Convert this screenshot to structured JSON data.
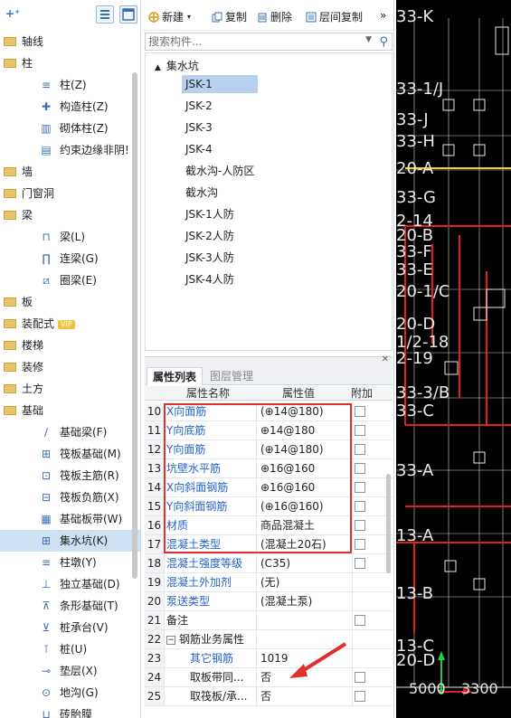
{
  "left_panel": {
    "categories": [
      {
        "label": "轴线",
        "expanded": false
      },
      {
        "label": "柱",
        "expanded": true,
        "items": [
          "柱(Z)",
          "构造柱(Z)",
          "砌体柱(Z)",
          "约束边缘非阴!"
        ]
      },
      {
        "label": "墙",
        "expanded": false
      },
      {
        "label": "门窗洞",
        "expanded": false
      },
      {
        "label": "梁",
        "expanded": true,
        "items": [
          "梁(L)",
          "连梁(G)",
          "圈梁(E)"
        ]
      },
      {
        "label": "板",
        "expanded": false
      },
      {
        "label": "装配式",
        "badge": "VIP",
        "expanded": false
      },
      {
        "label": "楼梯",
        "expanded": false
      },
      {
        "label": "装修",
        "expanded": false
      },
      {
        "label": "土方",
        "expanded": false
      },
      {
        "label": "基础",
        "expanded": true,
        "items": [
          "基础梁(F)",
          "筏板基础(M)",
          "筏板主筋(R)",
          "筏板负筋(X)",
          "基础板带(W)",
          "集水坑(K)",
          "柱墩(Y)",
          "独立基础(D)",
          "条形基础(T)",
          "桩承台(V)",
          "桩(U)",
          "垫层(X)",
          "地沟(G)",
          "砖胎膜"
        ]
      }
    ],
    "selected_item": "集水坑(K)"
  },
  "toolbar": {
    "new_label": "新建",
    "copy_label": "复制",
    "delete_label": "删除",
    "layer_copy_label": "层间复制",
    "more_label": "»"
  },
  "search": {
    "placeholder": "搜索构件..."
  },
  "component_tree": {
    "root_label": "集水坑",
    "items": [
      "JSK-1",
      "JSK-2",
      "JSK-3",
      "JSK-4",
      "截水沟-人防区",
      "截水沟",
      "JSK-1人防",
      "JSK-2人防",
      "JSK-3人防",
      "JSK-4人防"
    ],
    "selected": "JSK-1"
  },
  "property_panel": {
    "tabs": [
      "属性列表",
      "图层管理"
    ],
    "active_tab": "属性列表",
    "headers": {
      "name": "属性名称",
      "value": "属性值",
      "extra": "附加"
    },
    "rows": [
      {
        "num": "10",
        "name": "X向面筋",
        "value": "(⊕14@180)",
        "blue": true,
        "checkbox": true
      },
      {
        "num": "11",
        "name": "Y向底筋",
        "value": "⊕14@180",
        "blue": true,
        "checkbox": true
      },
      {
        "num": "12",
        "name": "Y向面筋",
        "value": "(⊕14@180)",
        "blue": true,
        "checkbox": true
      },
      {
        "num": "13",
        "name": "坑壁水平筋",
        "value": "⊕16@160",
        "blue": true,
        "checkbox": true
      },
      {
        "num": "14",
        "name": "X向斜面钢筋",
        "value": "⊕16@160",
        "blue": true,
        "checkbox": true
      },
      {
        "num": "15",
        "name": "Y向斜面钢筋",
        "value": "(⊕16@160)",
        "blue": true,
        "checkbox": true
      },
      {
        "num": "16",
        "name": "材质",
        "value": "商品混凝土",
        "blue": true,
        "checkbox": true
      },
      {
        "num": "17",
        "name": "混凝土类型",
        "value": "(混凝土20石)",
        "blue": true,
        "checkbox": true
      },
      {
        "num": "18",
        "name": "混凝土强度等级",
        "value": "(C35)",
        "blue": true,
        "checkbox": true
      },
      {
        "num": "19",
        "name": "混凝土外加剂",
        "value": "(无)",
        "blue": true,
        "checkbox": false
      },
      {
        "num": "20",
        "name": "泵送类型",
        "value": "(混凝土泵)",
        "blue": true,
        "checkbox": false
      },
      {
        "num": "21",
        "name": "备注",
        "value": "",
        "blue": false,
        "checkbox": true
      },
      {
        "num": "22",
        "name": "钢筋业务属性",
        "value": "",
        "blue": false,
        "checkbox": false,
        "group": true
      },
      {
        "num": "23",
        "name": "其它钢筋",
        "value": "1019",
        "blue": true,
        "checkbox": false,
        "indent": true
      },
      {
        "num": "24",
        "name": "取板带同...",
        "value": "否",
        "blue": false,
        "checkbox": true,
        "indent": true
      },
      {
        "num": "25",
        "name": "取筏板/承...",
        "value": "否",
        "blue": false,
        "checkbox": true,
        "indent": true
      }
    ]
  },
  "cad": {
    "axis_labels": [
      "33-K",
      "33-1/J",
      "33-J",
      "33-H",
      "20-A",
      "33-G",
      "2-14",
      "20-B",
      "33-F",
      "33-E",
      "20-1/C",
      "20-D",
      "1/2-18",
      "2-19",
      "33-3/B",
      "33-C",
      "33-A",
      "13-A",
      "13-B",
      "13-C",
      "20-D"
    ],
    "dimensions": [
      "5000",
      "3300"
    ],
    "colors": {
      "background": "#000000",
      "grid": "#d8d8d8",
      "walls": "#e02020",
      "green": "#22cc44",
      "yellow": "#f0d020"
    }
  }
}
